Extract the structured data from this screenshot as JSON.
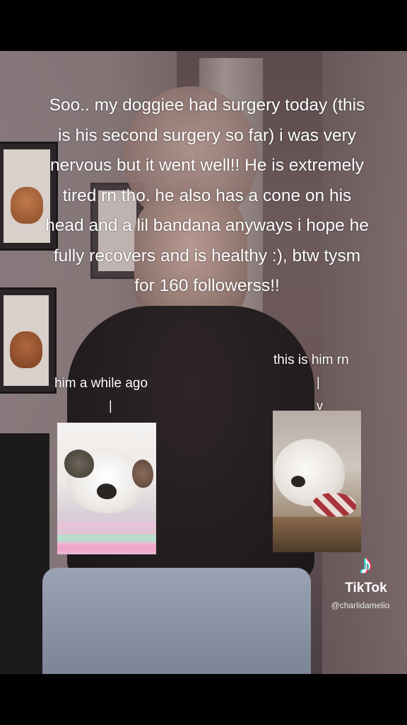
{
  "caption": "Soo.. my doggiee had surgery today (this is his second surgery so far) i was very nervous but it went well!! He is extremely tired rn tho.  he also has a cone on his head and a lil bandana anyways i hope he fully recovers and is healthy :), btw tysm for 160 followerss!!",
  "labels": {
    "before": "him a while ago",
    "now": "this is him rn"
  },
  "arrows": {
    "bar": "|",
    "head": "v"
  },
  "watermark": {
    "brand": "TikTok",
    "handle": "@charlidamelio"
  },
  "colors": {
    "text": "#ffffff",
    "tiktok_cyan": "#25f4ee",
    "tiktok_red": "#fe2c55"
  }
}
